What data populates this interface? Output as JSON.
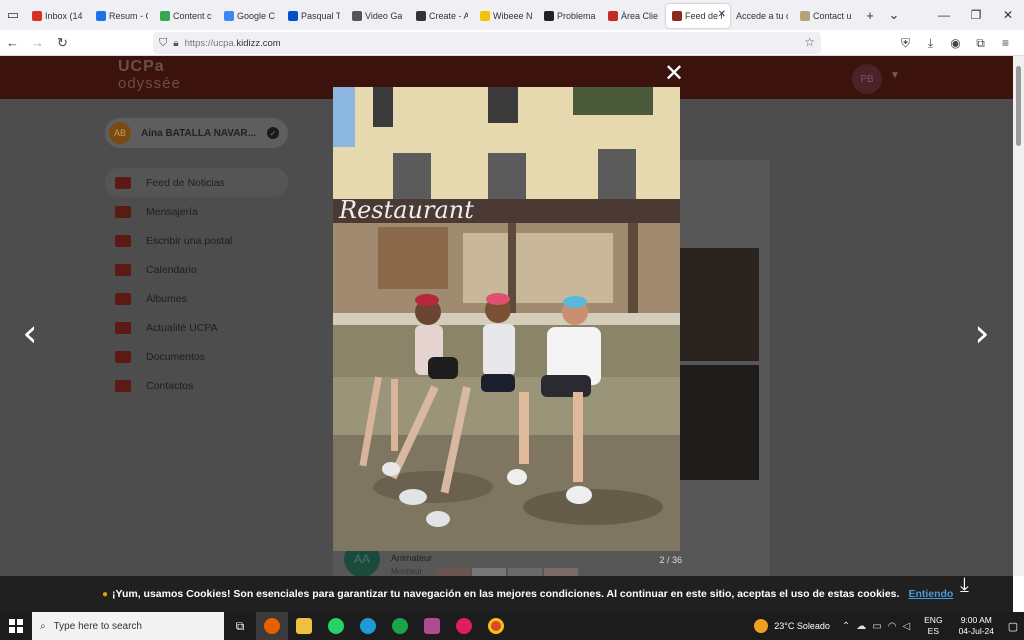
{
  "browser": {
    "tabs": [
      {
        "title": "Inbox (14",
        "color": "#d93025"
      },
      {
        "title": "Resum - C",
        "color": "#1a73e8"
      },
      {
        "title": "Content c",
        "color": "#34a853"
      },
      {
        "title": "Google C",
        "color": "#4285f4"
      },
      {
        "title": "Pasqual T",
        "color": "#0052cc"
      },
      {
        "title": "Video Ga",
        "color": "#555555"
      },
      {
        "title": "Create - A",
        "color": "#333333"
      },
      {
        "title": "Wibeee N",
        "color": "#f4c20d"
      },
      {
        "title": "Problema",
        "color": "#222222"
      },
      {
        "title": "Àrea Clie",
        "color": "#c62828"
      },
      {
        "title": "Feed de N",
        "color": "#8a2a1a"
      },
      {
        "title": "Accede a tu c",
        "color": "#ffffff"
      },
      {
        "title": "Contact u",
        "color": "#b5a27a"
      }
    ],
    "url_prefix": "https://ucpa.",
    "url_domain": "kidizz.com"
  },
  "site": {
    "logo_line1": "UCPa",
    "logo_line2": "odyssée",
    "header_avatar": "PB",
    "user_initials": "AB",
    "user_name": "Aina BATALLA NAVAR...",
    "menu": [
      {
        "label": "Feed de Noticias"
      },
      {
        "label": "Mensajería"
      },
      {
        "label": "Escribir una postal"
      },
      {
        "label": "Calendario"
      },
      {
        "label": "Álbumes"
      },
      {
        "label": "Actualité UCPA"
      },
      {
        "label": "Documentos"
      },
      {
        "label": "Contactos"
      }
    ],
    "comment_avatar": "AA",
    "comment_author": "Animateur",
    "comment_role": "Moniteur"
  },
  "lightbox": {
    "counter": "2 / 36",
    "sign_text": "Restaurant"
  },
  "cookie": {
    "message": "¡Yum, usamos Cookies! Son esenciales para garantizar tu navegación en las mejores condiciones. Al continuar en este sitio, aceptas el uso de estas cookies.",
    "accept": "Entiendo"
  },
  "taskbar": {
    "search_placeholder": "Type here to search",
    "weather": "23°C  Soleado",
    "lang_line1": "ENG",
    "lang_line2": "ES",
    "time": "9:00 AM",
    "date": "04-Jul-24"
  }
}
